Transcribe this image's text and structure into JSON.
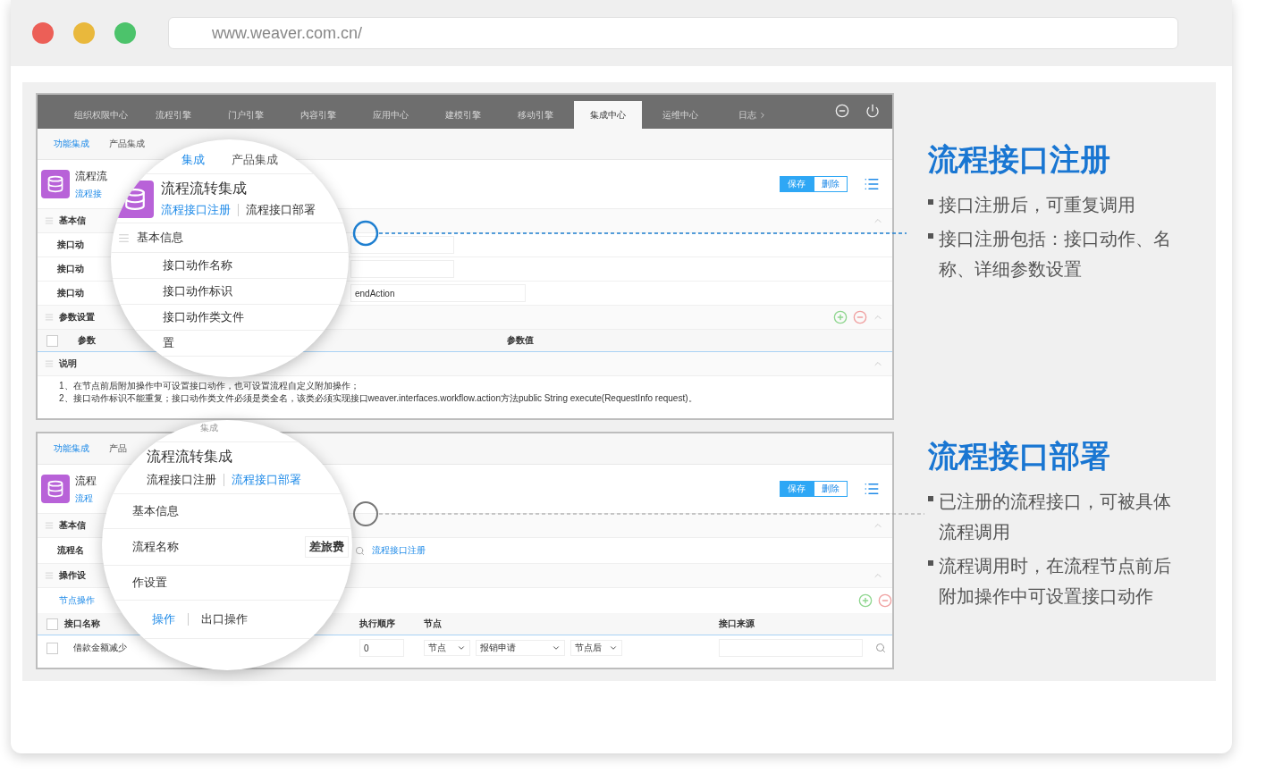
{
  "browser": {
    "url": "www.weaver.com.cn/"
  },
  "panel1": {
    "nav": [
      {
        "label": "组织权限中心",
        "selected": false
      },
      {
        "label": "流程引擎",
        "selected": false
      },
      {
        "label": "门户引擎",
        "selected": false
      },
      {
        "label": "内容引擎",
        "selected": false
      },
      {
        "label": "应用中心",
        "selected": false
      },
      {
        "label": "建模引擎",
        "selected": false
      },
      {
        "label": "移动引擎",
        "selected": false
      },
      {
        "label": "集成中心",
        "selected": true
      },
      {
        "label": "运维中心",
        "selected": false
      },
      {
        "label": "日志",
        "selected": false
      }
    ],
    "subtabs": [
      {
        "label": "功能集成",
        "selected": true
      },
      {
        "label": "产品集成",
        "selected": false
      }
    ],
    "title": "流程流",
    "subtitle": "流程接",
    "buttons": [
      "保存",
      "删除"
    ],
    "section_basic": "基本信",
    "fields": [
      {
        "label": "接口动"
      },
      {
        "label": "接口动"
      },
      {
        "label": "接口动",
        "value": "endAction"
      }
    ],
    "section_params": "参数设置",
    "param_checked": false,
    "param_columns": [
      "参数",
      "参数值"
    ],
    "section_notes": "说明",
    "notes": [
      "1、在节点前后附加操作中可设置接口动作，也可设置流程自定义附加操作；",
      "2、接口动作标识不能重复；接口动作类文件必须是类全名，该类必须实现接口weaver.interfaces.workflow.action方法public String execute(RequestInfo request)。"
    ]
  },
  "magnifier1": {
    "subtabs": [
      {
        "label": "集成",
        "selected": true
      },
      {
        "label": "产品集成",
        "selected": false
      }
    ],
    "title": "流程流转集成",
    "links": [
      {
        "label": "流程接口注册",
        "selected": true
      },
      {
        "label": "流程接口部署",
        "selected": false
      }
    ],
    "section": "基本信息",
    "fields": [
      "接口动作名称",
      "接口动作标识",
      "接口动作类文件",
      "置"
    ]
  },
  "panel2": {
    "subtabs": [
      {
        "label": "功能集成",
        "selected": true
      },
      {
        "label": "产品",
        "selected": false
      }
    ],
    "title": "流程",
    "subtitle": "流程",
    "buttons": [
      "保存",
      "删除"
    ],
    "section_basic": "基本信",
    "field_label": "流程名",
    "field_link": "流程接口注册",
    "section_ops": "操作设",
    "ops_link": "节点操作",
    "header_checked": false,
    "columns": [
      "接口名称",
      "执行顺序",
      "节点",
      "接口来源"
    ],
    "row": {
      "checked": false,
      "name": "借款金额减少",
      "order": "0",
      "node": "节点",
      "workflow": "报销申请",
      "timing": "节点后"
    }
  },
  "magnifier2": {
    "top": "集成",
    "title": "流程流转集成",
    "links": [
      {
        "label": "流程接口注册",
        "selected": false
      },
      {
        "label": "流程接口部署",
        "selected": true
      }
    ],
    "section": "基本信息",
    "field": {
      "label": "流程名称",
      "value": "差旅费"
    },
    "section2": "作设置",
    "tabs": [
      {
        "label": "操作",
        "selected": true
      },
      {
        "label": "出口操作",
        "selected": false
      }
    ]
  },
  "features": [
    {
      "heading": "流程接口注册",
      "bullets": [
        "接口注册后，可重复调用",
        "接口注册包括：接口动作、名称、详细参数设置"
      ]
    },
    {
      "heading": "流程接口部署",
      "bullets": [
        "已注册的流程接口，可被具体流程调用",
        "流程调用时，在流程节点前后附加操作中可设置接口动作"
      ]
    }
  ]
}
